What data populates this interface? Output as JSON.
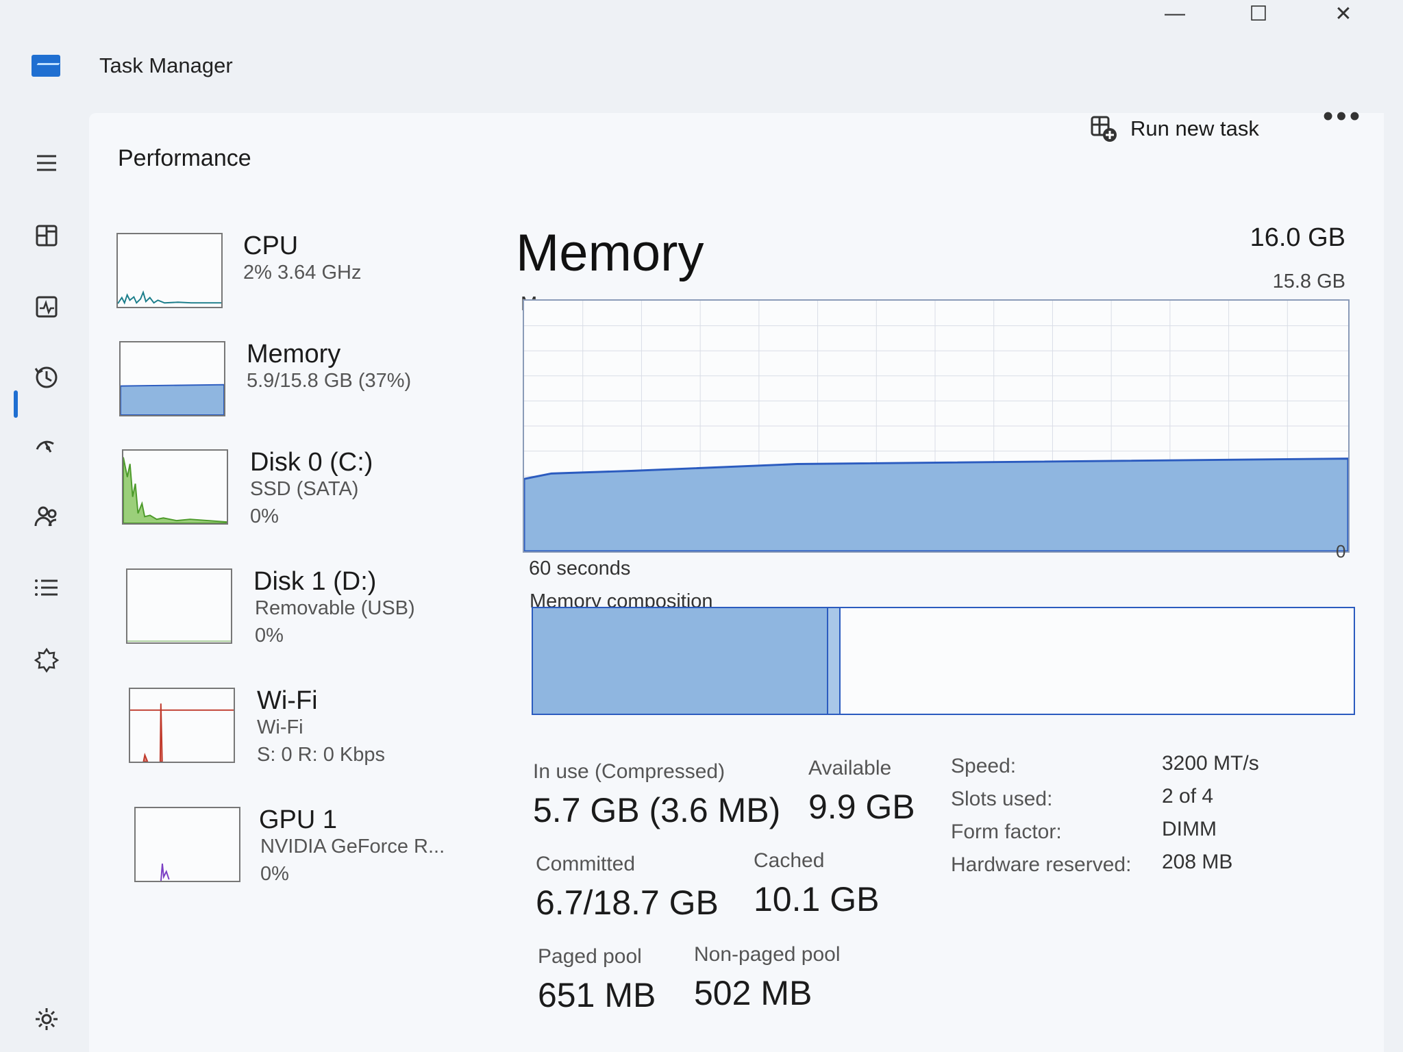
{
  "app": {
    "title": "Task Manager"
  },
  "window_controls": {
    "minimize": "—",
    "maximize": "☐",
    "close": "✕"
  },
  "nav": {
    "items": [
      {
        "name": "hamburger-menu-icon"
      },
      {
        "name": "processes-icon"
      },
      {
        "name": "performance-icon",
        "active": true
      },
      {
        "name": "app-history-icon"
      },
      {
        "name": "startup-apps-icon"
      },
      {
        "name": "users-icon"
      },
      {
        "name": "details-icon"
      },
      {
        "name": "services-icon"
      },
      {
        "name": "settings-icon"
      }
    ]
  },
  "header": {
    "page_title": "Performance",
    "run_new_task": "Run new task",
    "more": "•••"
  },
  "perf_list": [
    {
      "name": "CPU",
      "sub1": "2% 3.64 GHz",
      "sub2": "",
      "color": "#1a7d8a",
      "level": 0.02
    },
    {
      "name": "Memory",
      "sub1": "5.9/15.8 GB (37%)",
      "sub2": "",
      "color": "#2b5bbf",
      "level": 0.37,
      "selected": true
    },
    {
      "name": "Disk 0 (C:)",
      "sub1": "SSD (SATA)",
      "sub2": "0%",
      "color": "#4c9a2a",
      "level": 0.0
    },
    {
      "name": "Disk 1 (D:)",
      "sub1": "Removable (USB)",
      "sub2": "0%",
      "color": "#4c9a2a",
      "level": 0.0
    },
    {
      "name": "Wi-Fi",
      "sub1": "Wi-Fi",
      "sub2": "S: 0 R: 0 Kbps",
      "color": "#c0392b",
      "level": 0.0
    },
    {
      "name": "GPU 1",
      "sub1": "NVIDIA GeForce R...",
      "sub2": "0%",
      "color": "#7b3fc4",
      "level": 0.0
    }
  ],
  "detail": {
    "title": "Memory",
    "total": "16.0 GB",
    "usage_label": "Memory usage",
    "usage_max": "15.8 GB",
    "axis_seconds": "60 seconds",
    "axis_zero": "0",
    "composition_label": "Memory composition",
    "usage_fraction": 0.37,
    "composition": {
      "in_use_fraction": 0.36,
      "modified_fraction": 0.015
    },
    "stats": {
      "in_use_label": "In use (Compressed)",
      "in_use_value": "5.7 GB (3.6 MB)",
      "available_label": "Available",
      "available_value": "9.9 GB",
      "committed_label": "Committed",
      "committed_value": "6.7/18.7 GB",
      "cached_label": "Cached",
      "cached_value": "10.1 GB",
      "paged_pool_label": "Paged pool",
      "paged_pool_value": "651 MB",
      "nonpaged_pool_label": "Non-paged pool",
      "nonpaged_pool_value": "502 MB"
    },
    "properties": [
      {
        "label": "Speed:",
        "value": "3200 MT/s"
      },
      {
        "label": "Slots used:",
        "value": "2 of 4"
      },
      {
        "label": "Form factor:",
        "value": "DIMM"
      },
      {
        "label": "Hardware reserved:",
        "value": "208 MB"
      }
    ]
  },
  "colors": {
    "accent": "#1f6fd1",
    "memory_fill": "#8fb6e0",
    "memory_line": "#2b5bbf"
  }
}
